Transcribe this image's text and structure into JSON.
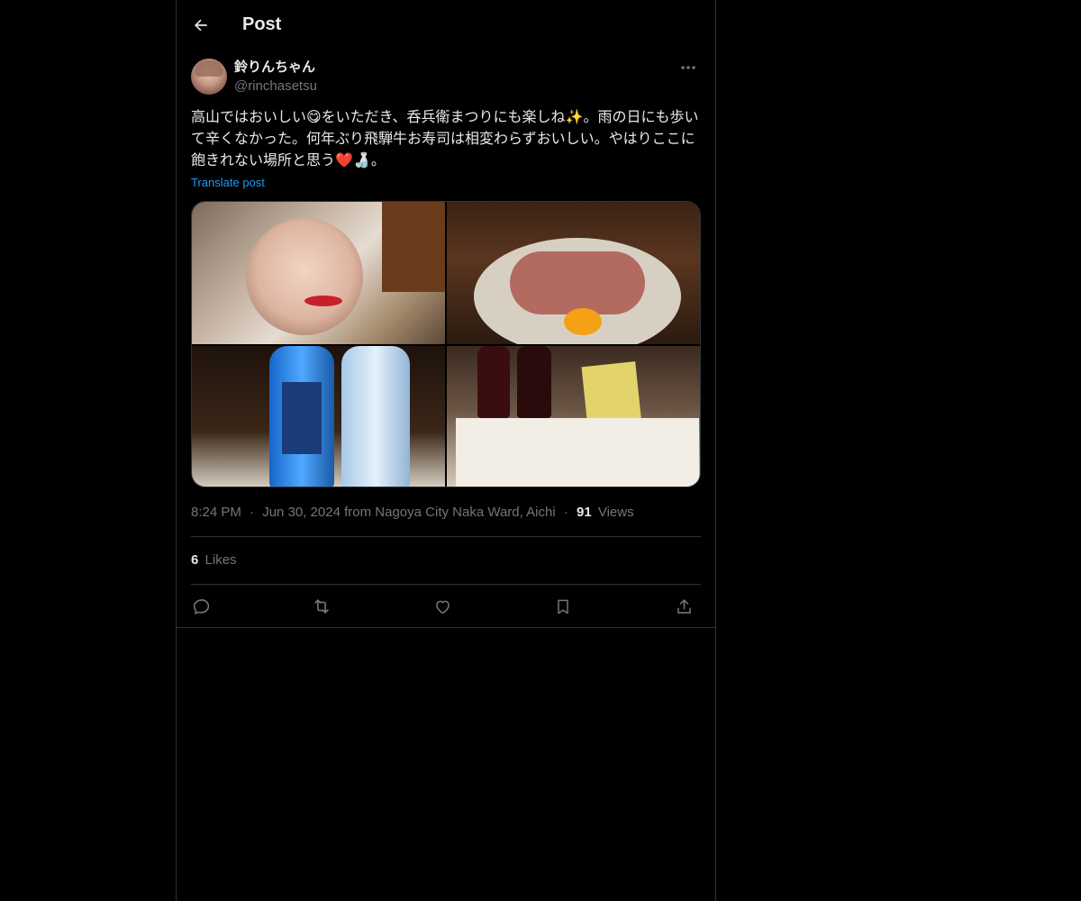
{
  "header": {
    "title": "Post"
  },
  "author": {
    "display_name": "鈴りんちゃん",
    "handle": "@rinchasetsu"
  },
  "tweet": {
    "text": "高山ではおいしい😋をいただき、呑兵衛まつりにも楽しね✨。雨の日にも歩いて辛くなかった。何年ぶり飛騨牛お寿司は相変わらずおいしい。やはりここに飽きれない場所と思う❤️🍶。",
    "translate_label": "Translate post"
  },
  "media": {
    "count": 4
  },
  "meta": {
    "time": "8:24 PM",
    "date_location": "Jun 30, 2024 from Nagoya City Naka Ward, Aichi",
    "views_count": "91",
    "views_label": "Views",
    "separator": "·"
  },
  "stats": {
    "likes_count": "6",
    "likes_label": "Likes"
  },
  "icons": {
    "back": "arrow-left-icon",
    "more": "more-icon",
    "reply": "reply-icon",
    "repost": "repost-icon",
    "like": "heart-icon",
    "bookmark": "bookmark-icon",
    "share": "share-icon"
  },
  "colors": {
    "background": "#000000",
    "text_primary": "#e7e9ea",
    "text_secondary": "#71767b",
    "link": "#1d9bf0",
    "border": "#2f3336"
  }
}
